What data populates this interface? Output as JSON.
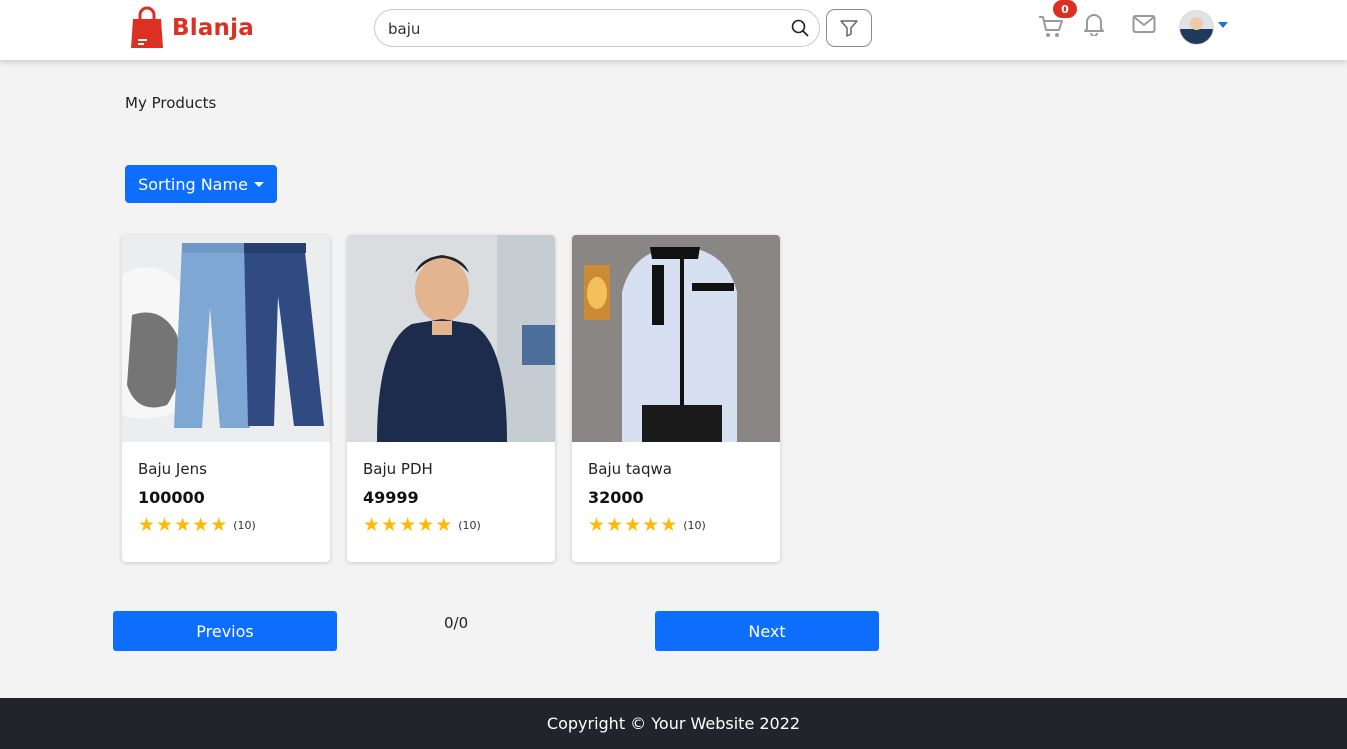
{
  "header": {
    "brand": "Blanja",
    "search": {
      "value": "baju",
      "placeholder": ""
    },
    "cart_count": "0",
    "icons": [
      "shopping-bag-icon",
      "search-icon",
      "filter-icon",
      "cart-icon",
      "bell-icon",
      "mail-icon",
      "avatar",
      "chevron-down-icon"
    ]
  },
  "main": {
    "title": "My Products",
    "sort_label": "Sorting Name",
    "products": [
      {
        "name": "Baju Jens",
        "price": "100000",
        "rating_count": "(10)",
        "rating": 5
      },
      {
        "name": "Baju PDH",
        "price": "49999",
        "rating_count": "(10)",
        "rating": 5
      },
      {
        "name": "Baju taqwa",
        "price": "32000",
        "rating_count": "(10)",
        "rating": 5
      }
    ],
    "pagination": {
      "prev_label": "Previos",
      "next_label": "Next",
      "page_info": "0/0"
    }
  },
  "footer": {
    "copyright": "Copyright © Your Website 2022"
  },
  "colors": {
    "brand": "#db3022",
    "primary": "#0d6efd",
    "star": "#ffba08",
    "footer_bg": "#212529"
  }
}
